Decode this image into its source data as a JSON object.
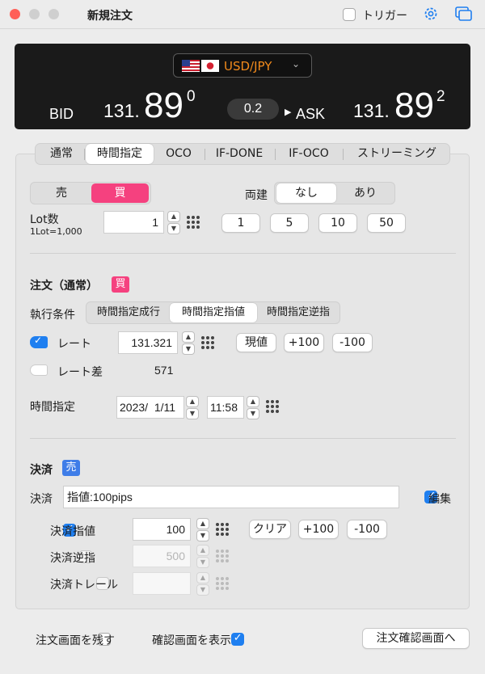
{
  "window": {
    "title": "新規注文",
    "trigger_label": "トリガー"
  },
  "ticker": {
    "pair": "USD/JPY",
    "bid_label": "BID",
    "bid_prefix": "131.",
    "bid_big": "89",
    "bid_sup": "0",
    "spread": "0.2",
    "ask_label": "ASK",
    "ask_prefix": "131.",
    "ask_big": "89",
    "ask_sup": "2"
  },
  "tabs": [
    "通常",
    "時間指定",
    "OCO",
    "IF-DONE",
    "IF-OCO",
    "ストリーミング"
  ],
  "side": {
    "sell": "売",
    "buy": "買"
  },
  "ryodate": {
    "label": "両建",
    "none": "なし",
    "yes": "あり"
  },
  "lot": {
    "label": "Lot数",
    "sub": "1Lot=1,000",
    "value": "1",
    "quick": [
      "1",
      "5",
      "10",
      "50"
    ]
  },
  "order": {
    "heading": "注文（通常）",
    "badge": "買",
    "exec_label": "執行条件",
    "exec_options": [
      "時間指定成行",
      "時間指定指値",
      "時間指定逆指"
    ],
    "rate_label": "レート",
    "rate_value": "131.321",
    "rate_btns": [
      "現値",
      "+100",
      "-100"
    ],
    "rate_diff_label": "レート差",
    "rate_diff_value": "571",
    "time_label": "時間指定",
    "date_value": "2023/  1/11",
    "time_value": "11:58"
  },
  "settle": {
    "heading": "決済",
    "badge": "売",
    "label": "決済",
    "text": "指値:100pips",
    "edit_label": "編集",
    "limit_label": "決済指値",
    "limit_value": "100",
    "limit_btns": [
      "クリア",
      "+100",
      "-100"
    ],
    "stop_label": "決済逆指",
    "stop_value": "500",
    "trail_label": "決済トレール",
    "trail_value": ""
  },
  "footer": {
    "keep_label": "注文画面を残す",
    "confirm_label": "確認画面を表示",
    "submit": "注文確認画面へ"
  },
  "colors": {
    "buy": "#f5417f",
    "sell": "#3f7de8",
    "accent": "#1f7ff0",
    "pair": "#f08a1c"
  }
}
